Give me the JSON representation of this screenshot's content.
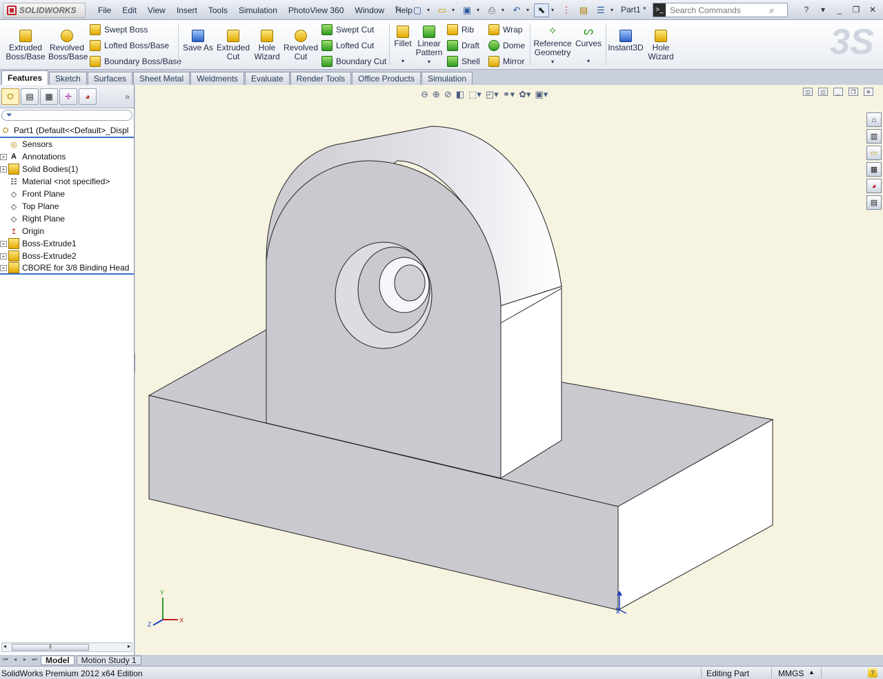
{
  "app": {
    "brand": "SOLIDWORKS",
    "doc_name": "Part1 *"
  },
  "menu": [
    "File",
    "Edit",
    "View",
    "Insert",
    "Tools",
    "Simulation",
    "PhotoView 360",
    "Window",
    "Help"
  ],
  "search": {
    "placeholder": "Search Commands"
  },
  "ribbon": {
    "extruded_boss": "Extruded\nBoss/Base",
    "revolved_boss": "Revolved\nBoss/Base",
    "swept_boss": "Swept Boss",
    "lofted_boss": "Lofted Boss/Base",
    "boundary_boss": "Boundary Boss/Base",
    "save_as": "Save As",
    "extruded_cut": "Extruded\nCut",
    "hole_wizard_1": "Hole\nWizard",
    "revolved_cut": "Revolved\nCut",
    "swept_cut": "Swept Cut",
    "lofted_cut": "Lofted Cut",
    "boundary_cut": "Boundary Cut",
    "fillet": "Fillet",
    "linear_pattern": "Linear\nPattern",
    "rib": "Rib",
    "draft": "Draft",
    "shell": "Shell",
    "wrap": "Wrap",
    "dome": "Dome",
    "mirror": "Mirror",
    "reference_geometry": "Reference\nGeometry",
    "curves": "Curves",
    "instant3d": "Instant3D",
    "hole_wizard_2": "Hole\nWizard"
  },
  "tabs": [
    "Features",
    "Sketch",
    "Surfaces",
    "Sheet Metal",
    "Weldments",
    "Evaluate",
    "Render Tools",
    "Office Products",
    "Simulation"
  ],
  "active_tab": "Features",
  "tree": {
    "root": "Part1  (Default<<Default>_Displ",
    "items": [
      {
        "label": "Sensors",
        "icon": "sensor-icon",
        "expandable": false
      },
      {
        "label": "Annotations",
        "icon": "annotation-icon",
        "expandable": true
      },
      {
        "label": "Solid Bodies(1)",
        "icon": "solid-bodies-icon",
        "expandable": true
      },
      {
        "label": "Material <not specified>",
        "icon": "material-icon",
        "expandable": false
      },
      {
        "label": "Front Plane",
        "icon": "plane-icon",
        "expandable": false
      },
      {
        "label": "Top Plane",
        "icon": "plane-icon",
        "expandable": false
      },
      {
        "label": "Right Plane",
        "icon": "plane-icon",
        "expandable": false
      },
      {
        "label": "Origin",
        "icon": "origin-icon",
        "expandable": false
      },
      {
        "label": "Boss-Extrude1",
        "icon": "extrude-feature-icon",
        "expandable": true
      },
      {
        "label": "Boss-Extrude2",
        "icon": "extrude-feature-icon",
        "expandable": true
      },
      {
        "label": "CBORE for 3/8 Binding Head",
        "icon": "hole-feature-icon",
        "expandable": true
      }
    ]
  },
  "bottom_tabs": [
    "Model",
    "Motion Study 1"
  ],
  "status": {
    "edition": "SolidWorks Premium 2012 x64 Edition",
    "mode": "Editing Part",
    "units": "MMGS"
  },
  "triad": {
    "x": "X",
    "y": "Y",
    "z": "Z"
  },
  "colors": {
    "model_gray": "#c9c9cf",
    "model_white": "#ffffff",
    "viewport_bg": "#f6f3e1",
    "accent": "#3a6fc9"
  }
}
